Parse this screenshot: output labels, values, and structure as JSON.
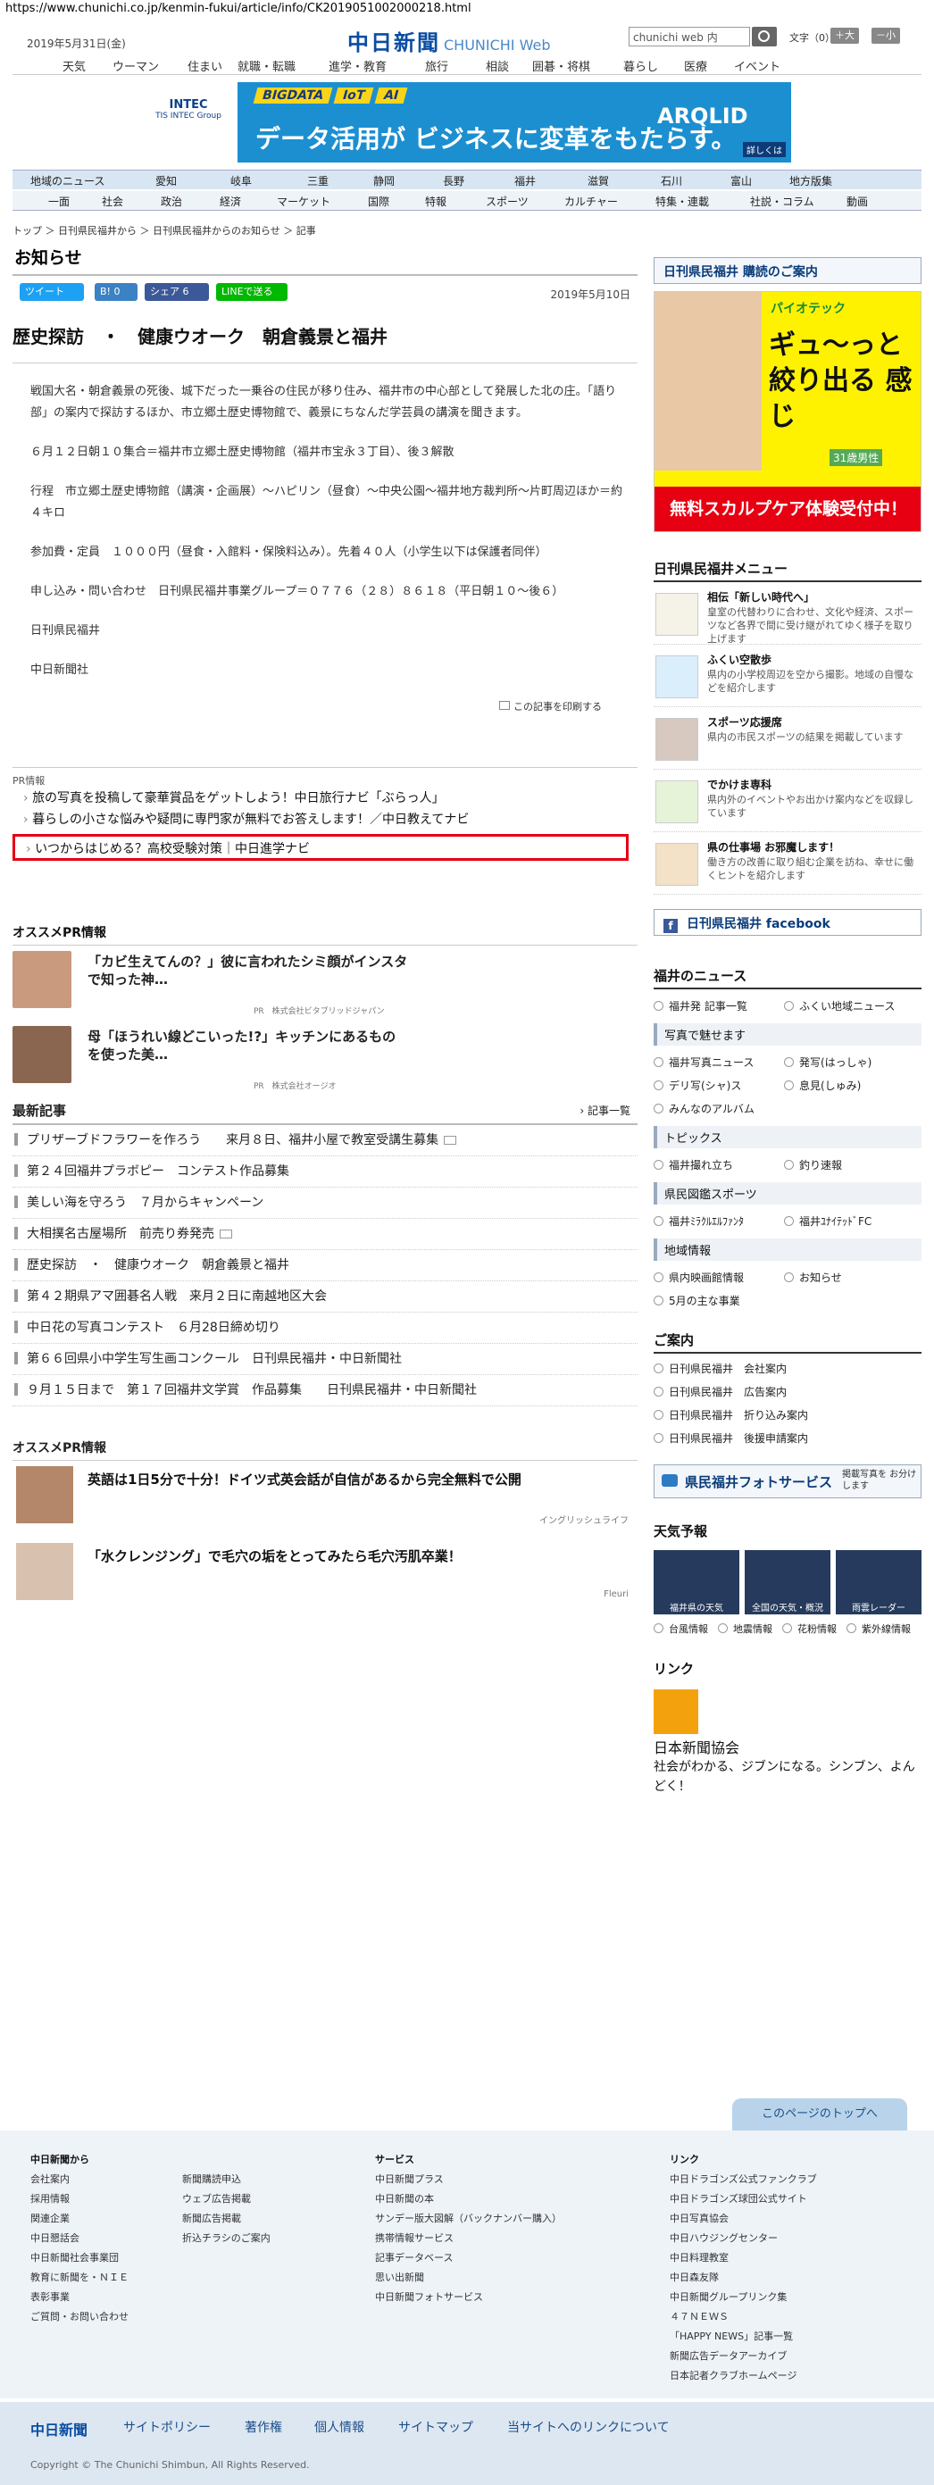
{
  "url": "https://www.chunichi.co.jp/kenmin-fukui/article/info/CK2019051002000218.html",
  "header": {
    "date": "2019年5月31日(金)",
    "logo": "中日新聞",
    "logo_web": "CHUNICHI Web",
    "search_value": "chunichi web 内",
    "font_size_label": "文字（0）",
    "size_up": "＋大",
    "size_down": "－小"
  },
  "top_nav": [
    "天気",
    "ウーマン",
    "住まい",
    "就職・転職",
    "進学・教育",
    "旅行",
    "相談",
    "囲碁・将棋",
    "暮らし",
    "医療",
    "イベント"
  ],
  "banner": {
    "left_text": "INTEC",
    "left_sub": "TIS INTEC Group",
    "tags": [
      "BIGDATA",
      "IoT",
      "AI"
    ],
    "copy": "データ活用が ビジネスに変革をもたらす。",
    "right": "ARQLID",
    "more": "詳しくは"
  },
  "region_bar": [
    "地域のニュース",
    "愛知",
    "岐阜",
    "三重",
    "静岡",
    "長野",
    "福井",
    "滋賀",
    "石川",
    "富山",
    "地方版集"
  ],
  "category_bar": [
    "一面",
    "社会",
    "政治",
    "経済",
    "マーケット",
    "国際",
    "特報",
    "スポーツ",
    "カルチャー",
    "特集・連載",
    "社説・コラム",
    "動画"
  ],
  "breadcrumb": "トップ ＞ 日刊県民福井から ＞ 日刊県民福井からのお知らせ ＞ 記事",
  "main": {
    "page_title": "お知らせ",
    "share": [
      "ツイート",
      "B! 0",
      "シェア 6",
      "LINEで送る"
    ],
    "date": "2019年5月10日",
    "article_title": "歴史探訪　・　健康ウオーク　朝倉義景と福井",
    "paragraphs": [
      "戦国大名・朝倉義景の死後、城下だった一乗谷の住民が移り住み、福井市の中心部として発展した北の庄。「語り部」の案内で探訪するほか、市立郷土歴史博物館で、義景にちなんだ学芸員の講演を聞きます。",
      "６月１２日朝１０集合＝福井市立郷土歴史博物館（福井市宝永３丁目）、後３解散",
      "行程　市立郷土歴史博物館（講演・企画展）～ハピリン（昼食）～中央公園～福井地方裁判所～片町周辺ほか＝約４キロ",
      "参加費・定員　１０００円（昼食・入館料・保険料込み）。先着４０人（小学生以下は保護者同伴）",
      "申し込み・問い合わせ　日刊県民福井事業グループ＝０７７６（２８）８６１８（平日朝１０～後６）",
      "日刊県民福井",
      "中日新聞社"
    ],
    "print_label": "この記事を印刷する",
    "pr_label": "PR情報",
    "pr_links": [
      "旅の写真を投稿して豪華賞品をゲットしよう！中日旅行ナビ「ぶらっ人」",
      "暮らしの小さな悩みや疑問に専門家が無料でお答えします！／中日教えてナビ",
      "いつからはじめる？高校受験対策｜中日進学ナビ"
    ],
    "osusume_title": "オススメPR情報",
    "osusume": [
      {
        "title": "「カビ生えてんの？」彼に言われたシミ顔がインスタで知った神…",
        "sponsor": "PR　株式会社ビタブリッドジャパン"
      },
      {
        "title": "母「ほうれい線どこいった!?」キッチンにあるものを使った美…",
        "sponsor": "PR　株式会社オージオ"
      }
    ],
    "latest_title": "最新記事",
    "latest_more": "記事一覧",
    "latest": [
      "プリザーブドフラワーを作ろう　　来月８日、福井小屋で教室受講生募集",
      "第２４回福井プラボピー　コンテスト作品募集",
      "美しい海を守ろう　７月からキャンペーン",
      "大相撲名古屋場所　前売り券発売",
      "歴史探訪　・　健康ウオーク　朝倉義景と福井",
      "第４２期県アマ囲碁名人戦　来月２日に南越地区大会",
      "中日花の写真コンテスト　６月28日締め切り",
      "第６６回県小中学生写生画コンクール　日刊県民福井・中日新聞社",
      "９月１５日まで　第１７回福井文学賞　作品募集　　日刊県民福井・中日新聞社"
    ],
    "osusume2_title": "オススメPR情報",
    "osusume2": [
      {
        "title": "英語は1日5分で十分！ドイツ式英会話が自信があるから完全無料で公開",
        "sponsor": "イングリッシュライフ"
      },
      {
        "title": "「水クレンジング」で毛穴の垢をとってみたら毛穴汚肌卒業！",
        "sponsor": "Fleuri"
      }
    ]
  },
  "side": {
    "subscribe": "日刊県民福井 購読のご案内",
    "ad": {
      "t1": "パイオテック",
      "t2": "ギュ～っと 絞り出る 感じ",
      "t3": "31歳男性",
      "foot": "無料スカルプケア体験受付中！"
    },
    "menu_title": "日刊県民福井メニュー",
    "menu": [
      {
        "title": "相伝「新しい時代へ」",
        "desc": "皇室の代替わりに合わせ、文化や経済、スポーツなど各界で間に受け継がれてゆく様子を取り上げます"
      },
      {
        "title": "ふくい空散歩",
        "desc": "県内の小学校周辺を空から撮影。地域の自慢などを紹介します"
      },
      {
        "title": "スポーツ応援席",
        "desc": "県内の市民スポーツの結果を掲載しています"
      },
      {
        "title": "でかけま専科",
        "desc": "県内外のイベントやお出かけ案内などを収録しています"
      },
      {
        "title": "県の仕事場 お邪魔します！",
        "desc": "働き方の改善に取り組む企業を訪ね、幸せに働くヒントを紹介します"
      }
    ],
    "facebook": "日刊県民福井 facebook",
    "news_title": "福井のニュース",
    "news_a": [
      "福井発 記事一覧",
      "ふくい地域ニュース"
    ],
    "photo_h": "写真で魅せます",
    "photo": [
      "福井写真ニュース",
      "発写(はっしゃ)",
      "デリ写(シャ)ス",
      "息見(しゅみ)",
      "みんなのアルバム"
    ],
    "topics_h": "トピックス",
    "topics": [
      "福井撮れ立ち",
      "釣り速報"
    ],
    "sports_h": "県民図鑑スポーツ",
    "sports": [
      "福井ﾐﾗｸﾙｴﾙﾌｧﾝﾀ",
      "福井ﾕﾅｲﾃｯﾄﾞFC"
    ],
    "info_h": "地域情報",
    "info": [
      "県内映画館情報",
      "お知らせ",
      "5月の主な事業"
    ],
    "guide_title": "ご案内",
    "guide": [
      "日刊県民福井　会社案内",
      "日刊県民福井　広告案内",
      "日刊県民福井　折り込み案内",
      "日刊県民福井　後援申請案内"
    ],
    "photo_service": "県民福井フォトサービス",
    "photo_service_sub": "掲載写真を お分けします",
    "weather_title": "天気予報",
    "weather": [
      "福井県の天気",
      "全国の天気・概況",
      "雨雲レーダー"
    ],
    "weather_links": [
      "台風情報",
      "地震情報",
      "花粉情報",
      "紫外線情報"
    ],
    "link_title": "リンク",
    "link_name": "日本新聞協会",
    "link_desc": "社会がわかる、ジブンになる。シンブン、よんどく！"
  },
  "footer": {
    "to_top": "このページのトップへ",
    "col1_h": "中日新聞から",
    "col1": [
      "会社案内",
      "採用情報",
      "関連企業",
      "中日懇話会",
      "中日新聞社会事業団",
      "教育に新聞を・ＮＩＥ",
      "表彰事業",
      "ご質問・お問い合わせ"
    ],
    "col2": [
      "新聞購読申込",
      "ウェブ広告掲載",
      "新聞広告掲載",
      "折込チラシのご案内"
    ],
    "col3_h": "サービス",
    "col3": [
      "中日新聞プラス",
      "中日新聞の本",
      "サンデー版大図解（バックナンバー購入）",
      "携帯情報サービス",
      "記事データベース",
      "思い出新聞",
      "中日新聞フォトサービス"
    ],
    "col4_h": "リンク",
    "col4": [
      "中日ドラゴンズ公式ファンクラブ",
      "中日ドラゴンズ球団公式サイト",
      "中日写真協会",
      "中日ハウジングセンター",
      "中日料理教室",
      "中日森友隊",
      "中日新聞グループリンク集",
      "４７ＮＥＷＳ",
      "「HAPPY NEWS」記事一覧",
      "新聞広告データアーカイブ",
      "日本記者クラブホームページ"
    ],
    "bar": [
      "中日新聞",
      "サイトポリシー",
      "著作権",
      "個人情報",
      "サイトマップ",
      "当サイトへのリンクについて"
    ],
    "copyright": "Copyright © The Chunichi Shimbun, All Rights Reserved."
  }
}
